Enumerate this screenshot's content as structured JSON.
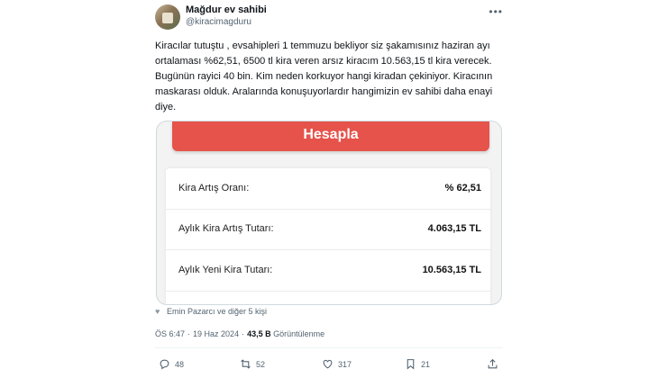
{
  "author": {
    "display_name": "Mağdur ev sahibi",
    "handle": "@kiracimagduru"
  },
  "tweet": {
    "text": "Kiracılar tutuştu , evsahipleri 1 temmuzu bekliyor siz şakamısınız haziran ayı ortalaması %62,51,  6500 tl kira veren arsız kiracım 10.563,15 tl kira verecek. Bugünün rayici 40 bin. Kim neden korkuyor hangi kiradan çekiniyor. Kiracının maskarası olduk. Aralarında konuşuyorlardır hangimizin ev sahibi daha enayi diye."
  },
  "card": {
    "button_label": "Hesapla",
    "rows": [
      {
        "label": "Kira Artış Oranı:",
        "value": "% 62,51"
      },
      {
        "label": "Aylık Kira Artış Tutarı:",
        "value": "4.063,15 TL"
      },
      {
        "label": "Aylık Yeni Kira Tutarı:",
        "value": "10.563,15 TL"
      }
    ]
  },
  "liked_by": "Emin Pazarcı ve diğer 5 kişi",
  "meta": {
    "time": "ÖS 6:47",
    "date": "19 Haz 2024",
    "views_count": "43,5 B",
    "views_label": "Görüntülenme"
  },
  "actions": {
    "replies": "48",
    "retweets": "52",
    "likes": "317",
    "bookmarks": "21"
  },
  "icons": [
    "more-icon",
    "heart-icon",
    "reply-icon",
    "retweet-icon",
    "like-icon",
    "bookmark-icon",
    "share-icon"
  ]
}
